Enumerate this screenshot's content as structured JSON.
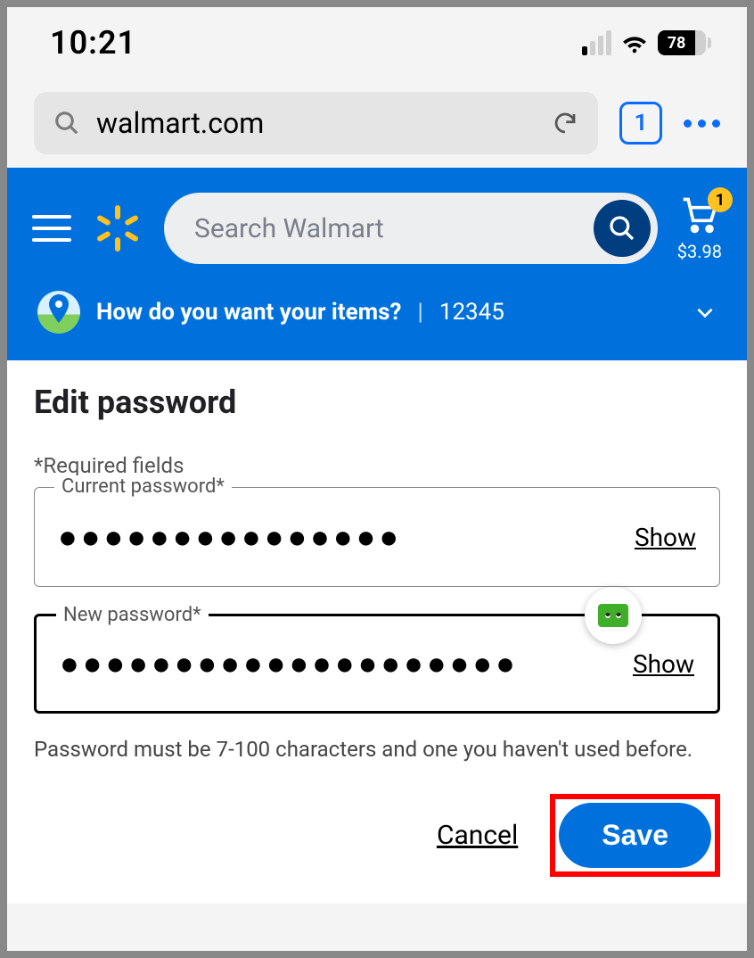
{
  "status": {
    "time": "10:21",
    "battery": "78"
  },
  "browser": {
    "url": "walmart.com",
    "tab_count": "1"
  },
  "header": {
    "search_placeholder": "Search Walmart",
    "cart_count": "1",
    "cart_total": "$3.98"
  },
  "fulfillment": {
    "prompt": "How do you want your items?",
    "separator": "|",
    "location": "12345"
  },
  "page": {
    "title": "Edit password",
    "required_note": "*Required fields",
    "current": {
      "label": "Current password*",
      "value_masked": "●●●●●●●●●●●●●●●",
      "show": "Show"
    },
    "new": {
      "label": "New password*",
      "value_masked": "●●●●●●●●●●●●●●●●●●●●",
      "show": "Show"
    },
    "hint": "Password must be 7-100 characters and one you haven't used before.",
    "cancel": "Cancel",
    "save": "Save"
  }
}
